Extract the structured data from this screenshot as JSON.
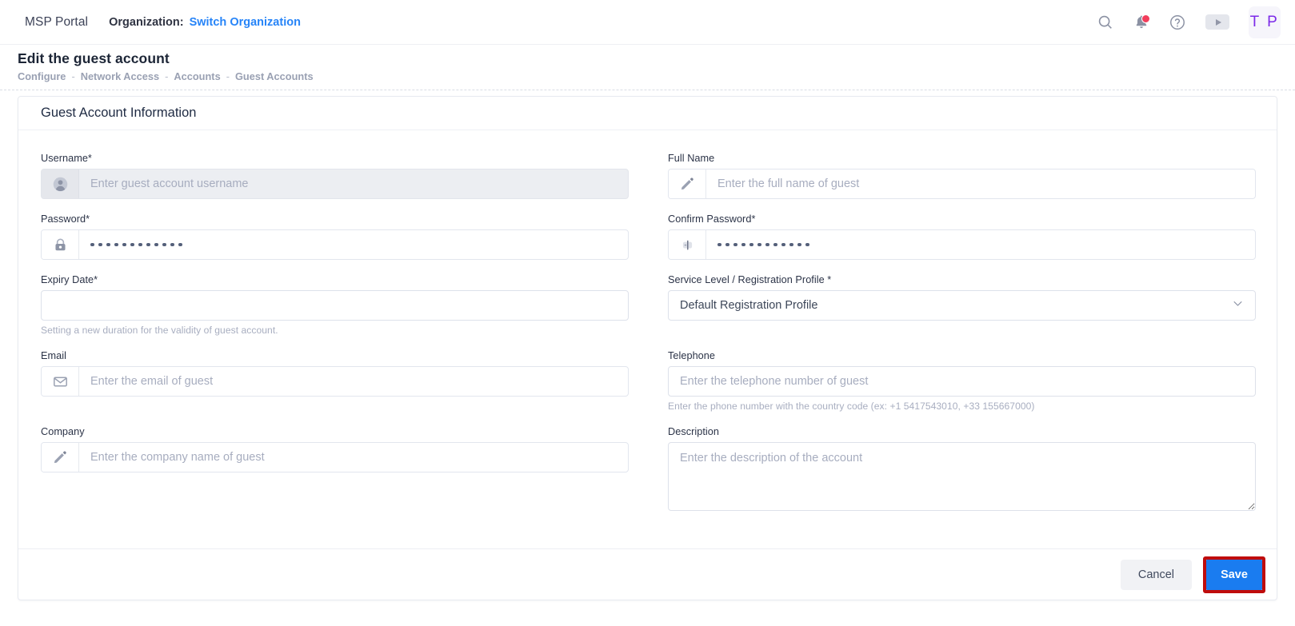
{
  "topbar": {
    "brand": "MSP Portal",
    "org_label": "Organization:",
    "switch_org_link": "Switch Organization",
    "icons": {
      "search": "search-icon",
      "notifications": "bell-icon",
      "help": "help-circle-icon",
      "video": "play-icon"
    },
    "avatar_initials": "T P",
    "accent_link_color": "#2684f8",
    "notification_dot_color": "#f23e5c"
  },
  "page": {
    "title": "Edit the guest account",
    "breadcrumbs": [
      "Configure",
      "Network Access",
      "Accounts",
      "Guest Accounts"
    ],
    "breadcrumb_separator": "-"
  },
  "card": {
    "title": "Guest Account Information"
  },
  "form": {
    "username": {
      "label": "Username*",
      "placeholder": "Enter guest account username",
      "value": "",
      "icon": "user-avatar-icon",
      "disabled": true
    },
    "full_name": {
      "label": "Full Name",
      "placeholder": "Enter the full name of guest",
      "value": "",
      "icon": "pencil-icon"
    },
    "password": {
      "label": "Password*",
      "value": "············",
      "masked_dot_count": 12,
      "icon": "lock-icon"
    },
    "confirm_password": {
      "label": "Confirm Password*",
      "value": "············",
      "masked_dot_count": 12,
      "icon": "lock-confirm-icon"
    },
    "expiry_date": {
      "label": "Expiry Date*",
      "placeholder": "",
      "value": "",
      "hint": "Setting a new duration for the validity of guest account."
    },
    "service_level": {
      "label": "Service Level / Registration Profile *",
      "value": "Default Registration Profile",
      "options": [
        "Default Registration Profile"
      ]
    },
    "email": {
      "label": "Email",
      "placeholder": "Enter the email of guest",
      "value": "",
      "icon": "envelope-icon"
    },
    "telephone": {
      "label": "Telephone",
      "placeholder": "Enter the telephone number of guest",
      "value": "",
      "hint": "Enter the phone number with the country code (ex: +1 5417543010, +33 155667000)"
    },
    "company": {
      "label": "Company",
      "placeholder": "Enter the company name of guest",
      "value": "",
      "icon": "pencil-icon"
    },
    "description": {
      "label": "Description",
      "placeholder": "Enter the description of the account",
      "value": ""
    }
  },
  "footer": {
    "cancel_label": "Cancel",
    "save_label": "Save",
    "save_color": "#1a7cf0",
    "save_highlight_color": "#bf0c0c"
  }
}
